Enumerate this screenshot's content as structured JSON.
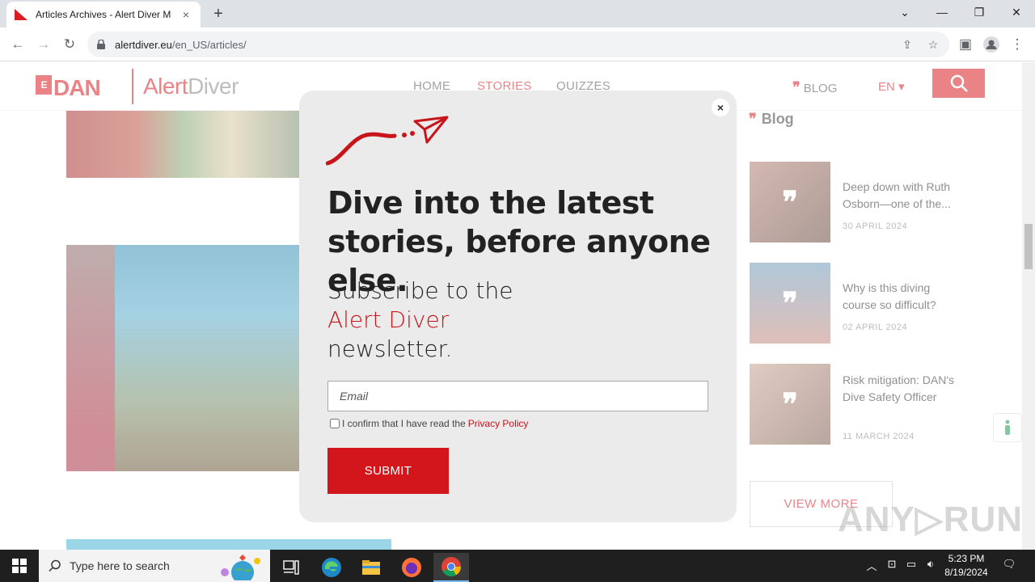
{
  "browser": {
    "tab_title": "Articles Archives - Alert Diver M",
    "tab_close": "×",
    "new_tab": "+",
    "url_domain": "alertdiver.eu",
    "url_path": "/en_US/articles/",
    "win_min": "—",
    "win_max": "❐",
    "win_close": "✕",
    "tab_list": "⌄"
  },
  "site": {
    "logo_dan": "DAN",
    "logo_alert": "Alert",
    "logo_diver": "Diver",
    "nav": [
      "HOME",
      "STORIES",
      "QUIZZES"
    ],
    "blog_label": "BLOG",
    "lang": "EN ▾"
  },
  "sidebar": {
    "title": "Blog",
    "posts": [
      {
        "title": "Deep down with Ruth Osborn—one of the...",
        "date": "30 APRIL 2024",
        "thumb_color": "#9a6a5a"
      },
      {
        "title": "Why is this diving course so difficult?",
        "date": "02 APRIL 2024",
        "thumb_color": "#6f8aa0"
      },
      {
        "title": "Risk mitigation: DAN's Dive Safety Officer",
        "date": "11 MARCH 2024",
        "thumb_color": "#a48070"
      }
    ],
    "view_more": "VIEW MORE"
  },
  "modal": {
    "headline": "Dive into the latest stories, before anyone else.",
    "sub_line1": "Subscribe to the",
    "sub_brand": "Alert Diver",
    "sub_line3": "newsletter.",
    "email_placeholder": "Email",
    "consent_text": "I confirm that I have read the",
    "privacy_link": "Privacy Policy",
    "submit": "SUBMIT",
    "close": "×"
  },
  "watermark": "ANY▷RUN",
  "taskbar": {
    "search_placeholder": "Type here to search",
    "time": "5:23 PM",
    "date": "8/19/2024"
  },
  "colors": {
    "brand_red": "#d91e24",
    "taskbar": "#1f1f1f"
  }
}
